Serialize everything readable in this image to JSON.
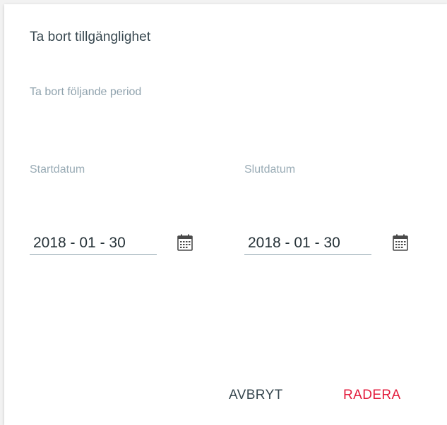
{
  "dialog": {
    "title": "Ta bort tillgänglighet",
    "subtitle": "Ta bort följande period"
  },
  "fields": {
    "start": {
      "label": "Startdatum",
      "value": "2018 - 01 - 30",
      "icon": "calendar-icon"
    },
    "end": {
      "label": "Slutdatum",
      "value": "2018 - 01 - 30",
      "icon": "calendar-icon"
    }
  },
  "actions": {
    "cancel_label": "AVBRYT",
    "delete_label": "RADERA"
  },
  "colors": {
    "title": "#37474f",
    "muted": "#8fa2ad",
    "danger": "#e31b3c"
  }
}
